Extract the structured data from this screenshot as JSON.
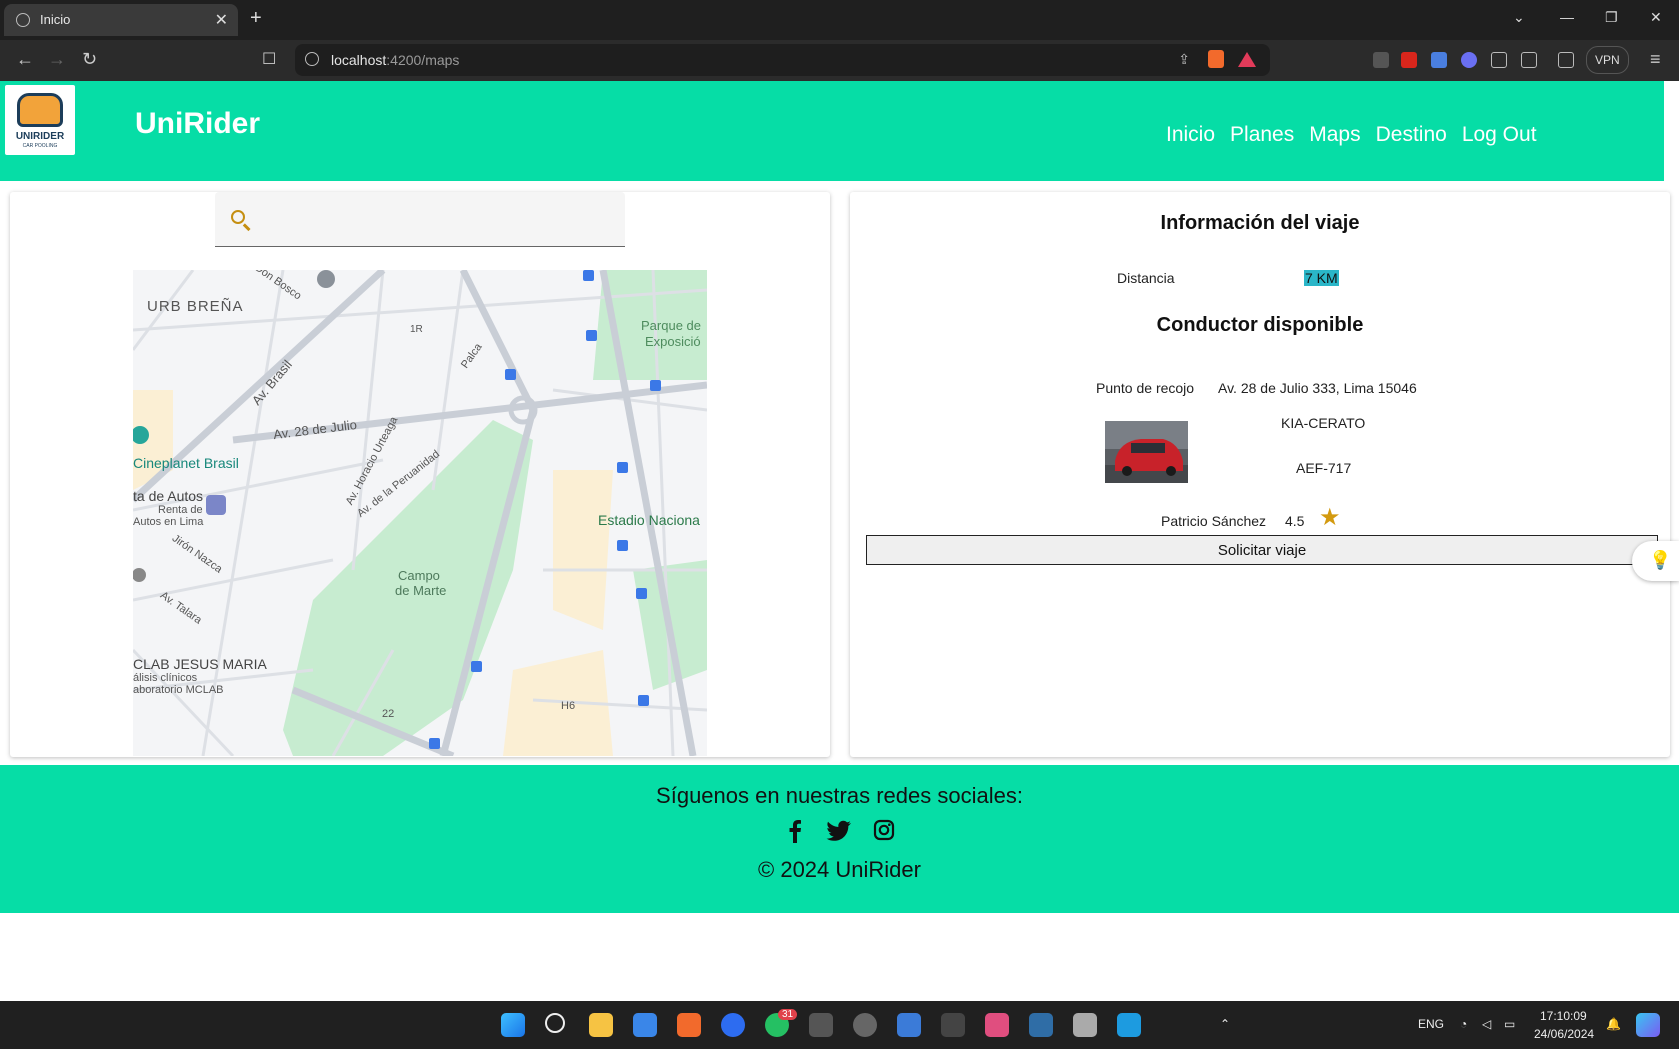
{
  "browser": {
    "tab_title": "Inicio",
    "url_host": "localhost",
    "url_rest": ":4200/maps",
    "vpn_label": "VPN"
  },
  "header": {
    "logo_text": "UNIRIDER",
    "logo_subtext": "CAR POOLING",
    "brand": "UniRider",
    "nav": [
      "Inicio",
      "Planes",
      "Maps",
      "Destino",
      "Log Out"
    ]
  },
  "search": {
    "placeholder": "",
    "value": ""
  },
  "map": {
    "labels": [
      "URB BREÑA",
      "Don Bosco",
      "Parque de",
      "Exposició",
      "Av. Brasil",
      "Av. 28 de Julio",
      "Cineplanet Brasil",
      "ta de Autos",
      "Renta de",
      "Autos en Lima",
      "Jirón Nazca",
      "Av. Talara",
      "CLAB JESUS MARIA",
      "álisis clínicos",
      "aboratorio MCLAB",
      "Campo",
      "de Marte",
      "Estadio Naciona",
      "Av. de la Peruanidad",
      "Av. Horacio Urteaga",
      "Palca",
      "H6",
      "22",
      "1R"
    ]
  },
  "trip": {
    "title": "Información del viaje",
    "distance_label": "Distancia",
    "distance_value": "7 KM",
    "driver_title": "Conductor disponible",
    "pickup_label": "Punto de recojo",
    "pickup_value": "Av. 28 de Julio 333, Lima 15046",
    "car_model": "KIA-CERATO",
    "plate": "AEF-717",
    "driver_name": "Patricio Sánchez",
    "rating": "4.5",
    "request_button": "Solicitar viaje"
  },
  "footer": {
    "follow": "Síguenos en nuestras redes sociales:",
    "copyright": "© 2024 UniRider"
  },
  "taskbar": {
    "whatsapp_badge": "31",
    "language": "ENG",
    "time": "17:10:09",
    "date": "24/06/2024"
  },
  "colors": {
    "accent": "#06dda6",
    "star": "#d39a10",
    "highlight": "#2ab6c8"
  }
}
